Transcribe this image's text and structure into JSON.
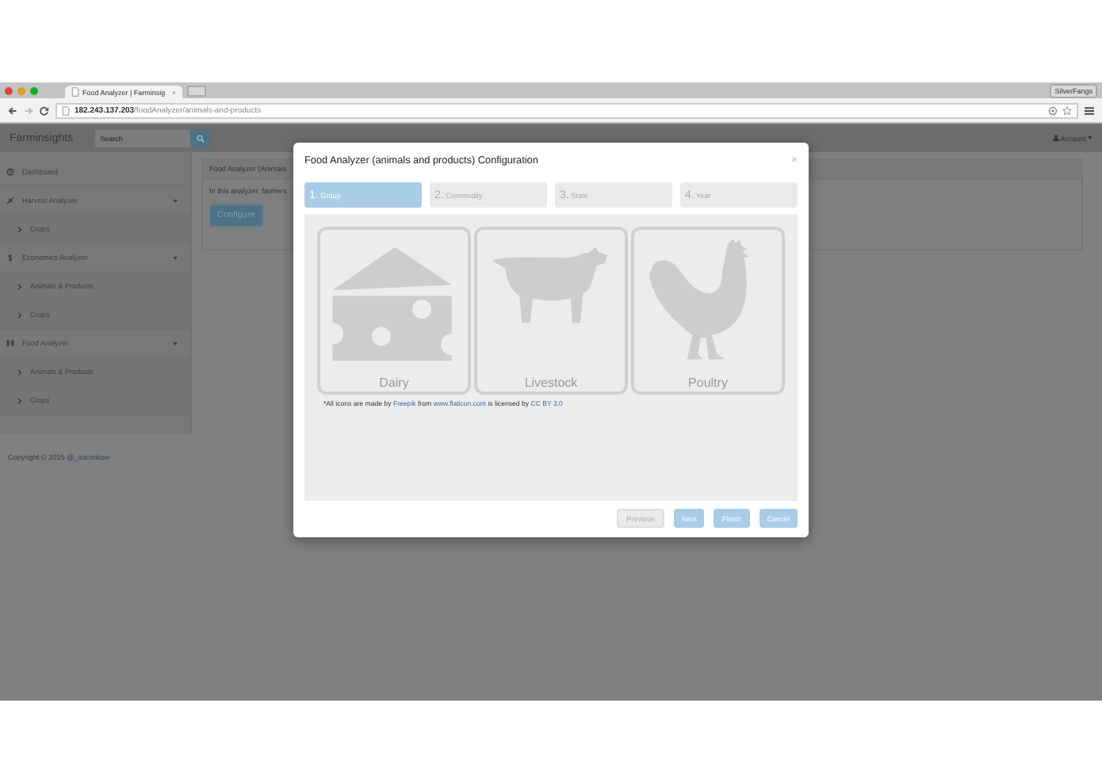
{
  "browser": {
    "tab_title": "Food Analyzer | Farminsig",
    "tab_close": "×",
    "profile": "SilverFangs",
    "url": "**182.243.137.203**/foodAnalyzer/animals-and-products"
  },
  "navbar": {
    "brand": "Farminsights",
    "search": {
      "placeholder": "Search"
    },
    "account": "Account"
  },
  "sidebar": {
    "items": [
      {
        "label": "Dashboard"
      },
      {
        "label": "Harvest Analyzer",
        "children": [
          {
            "label": "Crops"
          }
        ]
      },
      {
        "label": "Economics Analyzer",
        "children": [
          {
            "label": "Animals & Products"
          },
          {
            "label": "Crops"
          }
        ]
      },
      {
        "label": "Food Analyzer",
        "children": [
          {
            "label": "Animals & Products"
          },
          {
            "label": "Crops"
          }
        ]
      }
    ]
  },
  "panel": {
    "heading": "Food Analyzer (Animals",
    "text": "In this analyzer, farmers",
    "button": "Configure"
  },
  "footer": {
    "text": "Copyright © 2015",
    "link": "@_aaronkow"
  },
  "modal": {
    "title": "Food Analyzer (animals and products) Configuration",
    "close": "×",
    "steps": [
      {
        "number": "1.",
        "label": "Group",
        "selected": true
      },
      {
        "number": "2.",
        "label": "Commodity",
        "selected": false
      },
      {
        "number": "3.",
        "label": "State",
        "selected": false
      },
      {
        "number": "4.",
        "label": "Year",
        "selected": false
      }
    ],
    "options": [
      {
        "label": "Dairy"
      },
      {
        "label": "Livestock"
      },
      {
        "label": "Poultry"
      }
    ],
    "credit": [
      {
        "kind": "text",
        "text": "*All icons are made by"
      },
      {
        "kind": "link",
        "text": "Freepik"
      },
      {
        "kind": "text",
        "text": "from"
      },
      {
        "kind": "link",
        "text": "www.flaticon.com"
      },
      {
        "kind": "text",
        "text": "is licensed by"
      },
      {
        "kind": "link",
        "text": "CC BY 3.0"
      }
    ],
    "buttons": [
      {
        "label": "Previous",
        "disabled": true
      },
      {
        "label": "Next",
        "disabled": false
      },
      {
        "label": "Finish",
        "disabled": false
      },
      {
        "label": "Cancel",
        "disabled": false
      }
    ]
  }
}
